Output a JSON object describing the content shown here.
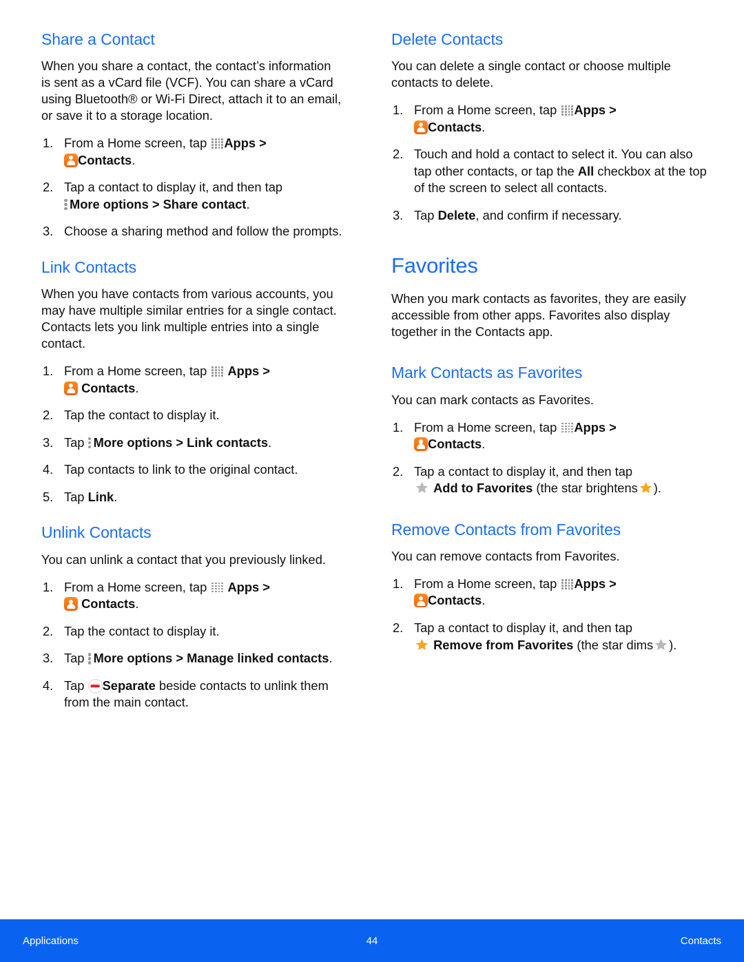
{
  "document": {
    "type": "user-manual-page",
    "page_number": "44",
    "colors": {
      "heading_blue": "#1b6ef3",
      "footer_blue": "#0a63f0",
      "contacts_icon_orange": "#f4630a",
      "star_active": "#f5a623",
      "star_inactive": "#b8b8b8",
      "separate_red": "#e8192c"
    }
  },
  "left_column": {
    "share_a_contact": {
      "heading": "Share a Contact",
      "intro": "When you share a contact, the contact’s information is sent as a vCard file (VCF). You can share a vCard using Bluetooth® or Wi-Fi Direct, attach it to an email, or save it to a storage location.",
      "step1_a": "From a Home screen, tap",
      "step1_apps": "Apps",
      "step1_gt": ">",
      "step1_contacts": "Contacts",
      "step1_period": ".",
      "step2_a": "Tap a contact to display it, and then tap",
      "step2_more": "More options > Share contact",
      "step2_period": ".",
      "step3": "Choose a sharing method and follow the prompts."
    },
    "link_contacts": {
      "heading": "Link Contacts",
      "intro": "When you have contacts from various accounts, you may have multiple similar entries for a single contact. Contacts lets you link multiple entries into a single contact.",
      "step1_a": "From a Home screen, tap",
      "step1_apps": "Apps",
      "step1_gt": ">",
      "step1_contacts": "Contacts",
      "step1_period": ".",
      "step2": "Tap the contact to display it.",
      "step3_tap": "Tap",
      "step3_more": "More options > Link contacts",
      "step3_period": ".",
      "step4": "Tap contacts to link to the original contact.",
      "step5_tap": "Tap",
      "step5_bold": "Link",
      "step5_period": "."
    },
    "unlink_contacts": {
      "heading": "Unlink Contacts",
      "intro": "You can unlink a contact that you previously linked.",
      "step1_a": "From a Home screen, tap",
      "step1_apps": "Apps",
      "step1_gt": ">",
      "step1_contacts": "Contacts",
      "step1_period": ".",
      "step2": "Tap the contact to display it.",
      "step3_tap": "Tap",
      "step3_more": "More options > Manage linked contacts",
      "step3_period": ".",
      "step4_tap": "Tap",
      "step4_bold": "Separate",
      "step4_rest": "beside contacts to unlink them from the main contact."
    }
  },
  "right_column": {
    "delete_contacts": {
      "heading": "Delete Contacts",
      "intro": "You can delete a single contact or choose multiple contacts to delete.",
      "step1_a": "From a Home screen, tap",
      "step1_apps": "Apps",
      "step1_gt": ">",
      "step1_contacts": "Contacts",
      "step1_period": ".",
      "step2_pre": "Touch and hold a contact to select it. You can also tap other contacts, or tap the",
      "step2_bold": "All",
      "step2_post": "checkbox at the top of the screen to select all contacts.",
      "step3_pre": "Tap",
      "step3_bold": "Delete",
      "step3_post": ", and confirm if necessary."
    },
    "favorites": {
      "heading": "Favorites",
      "intro": "When you mark contacts as favorites, they are easily accessible from other apps. Favorites also display together in the Contacts app."
    },
    "mark_contacts_as_favorites": {
      "heading": "Mark Contacts as Favorites",
      "intro": "You can mark contacts as Favorites.",
      "step1_a": "From a Home screen, tap",
      "step1_apps": "Apps",
      "step1_gt": ">",
      "step1_contacts": "Contacts",
      "step1_period": ".",
      "step2_a": "Tap a contact to display it, and then tap",
      "step2_bold": "Add to Favorites",
      "step2_paren_open": "(the star brightens",
      "step2_paren_close": ")."
    },
    "remove_contacts_from_favorites": {
      "heading": "Remove Contacts from Favorites",
      "intro": "You can remove contacts from Favorites.",
      "step1_a": "From a Home screen, tap",
      "step1_apps": "Apps",
      "step1_gt": ">",
      "step1_contacts": "Contacts",
      "step1_period": ".",
      "step2_a": "Tap a contact to display it, and then tap",
      "step2_bold": "Remove from Favorites",
      "step2_paren_open": "(the star dims",
      "step2_paren_close": ")."
    }
  },
  "footer": {
    "left": "Applications",
    "center": "44",
    "right": "Contacts"
  },
  "icons": {
    "apps": "apps-grid-icon",
    "contacts": "contacts-app-icon",
    "more_options": "more-options-icon",
    "separate": "separate-minus-icon",
    "star_on": "star-filled-icon",
    "star_off": "star-dim-icon"
  }
}
